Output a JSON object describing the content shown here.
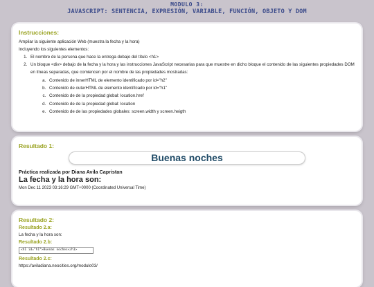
{
  "header": {
    "line1": "MODULO 3:",
    "line2": "JAVASCRIPT: SENTENCIA, EXPRESIÓN, VARIABLE, FUNCIÓN, OBJETO Y DOM"
  },
  "instructions": {
    "title": "Instrucciones:",
    "intro1": "Ampliar la siguiente aplicación Web (muestra la fecha y la hora)",
    "intro2": "Incluyendo los siguientes elementos:",
    "items": [
      "El nombre de la persona que hace la entrega debajo del título <h1>",
      "Un bloque <div> debajo de la fecha y la hora y las instrucciones JavaScript necesarias para que muestre en dicho bloque el contenido de las siguientes propiedades DOM en líneas separadas, que comiencen por el nombre de las propiedades mostradas:"
    ],
    "subitems": [
      "Contenido de innerHTML de elemento identificado por id=\"h2\"",
      "Contenido de outerHTML de elemento identificado por id=\"h1\"",
      "Contenido de de la propiedad global: location.href",
      "Contenido de de la propiedad global: location",
      "Contenido de de las propiedades globales: screen.width y screen.heigth"
    ]
  },
  "result1": {
    "title": "Resultado 1:",
    "greeting": "Buenas noches",
    "author": "Práctica realizada por Diana Avila Capristan",
    "heading": "La fecha y la hora son:",
    "datetime": "Mon Dec 11 2023 03:16:29 GMT+0000 (Coordinated Universal Time)"
  },
  "result2": {
    "title": "Resultado 2:",
    "a_title": "Resultado 2.a:",
    "a_text": "La fecha y la hora son:",
    "b_title": "Resultado 2.b:",
    "b_value": "<h1 id=\"h1\">Buenas noches</h1>",
    "c_title": "Resultado 2.c:",
    "c_text": "https://aviladiana.neocities.org/modulo03/"
  }
}
